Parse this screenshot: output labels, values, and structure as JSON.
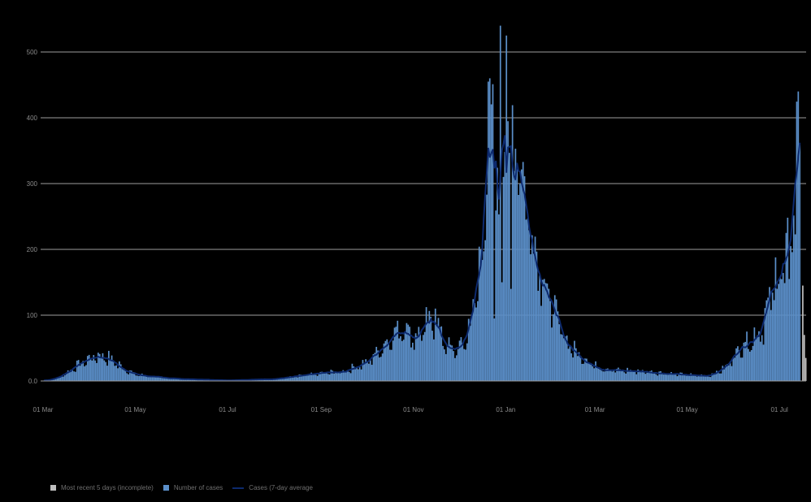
{
  "chart_data": {
    "type": "bar",
    "colors": {
      "bars": "#5b8fc9",
      "incomplete": "#bdbdbd",
      "line": "#0d2a6e",
      "grid": "#9e9e9e",
      "background": "#000000"
    },
    "x_start": "2020-03-01",
    "x_tick_labels": [
      "01 Mar",
      "01 May",
      "01 Jul",
      "01 Sep",
      "01 Nov",
      "01 Jan",
      "01 Mar",
      "01 May",
      "01 Jul"
    ],
    "x_tick_dates": [
      "2020-03-01",
      "2020-05-01",
      "2020-07-01",
      "2020-09-01",
      "2020-11-01",
      "2021-01-01",
      "2021-03-01",
      "2021-05-01",
      "2021-07-01"
    ],
    "y_ticks": [
      0,
      100,
      200,
      300,
      400,
      500
    ],
    "y_tick_labels": [
      "0.0",
      "100",
      "200",
      "300",
      "400",
      "500"
    ],
    "ylim": [
      0,
      540
    ],
    "grid": true,
    "legend_position": "bottom-left",
    "daily_anchors": [
      [
        "2020-03-01",
        0
      ],
      [
        "2020-03-10",
        4
      ],
      [
        "2020-03-18",
        15
      ],
      [
        "2020-03-25",
        26
      ],
      [
        "2020-04-01",
        35
      ],
      [
        "2020-04-07",
        40
      ],
      [
        "2020-04-15",
        32
      ],
      [
        "2020-04-22",
        20
      ],
      [
        "2020-05-01",
        10
      ],
      [
        "2020-05-15",
        6
      ],
      [
        "2020-06-01",
        3
      ],
      [
        "2020-07-01",
        1
      ],
      [
        "2020-08-01",
        3
      ],
      [
        "2020-08-20",
        8
      ],
      [
        "2020-09-01",
        12
      ],
      [
        "2020-09-15",
        14
      ],
      [
        "2020-10-01",
        28
      ],
      [
        "2020-10-10",
        50
      ],
      [
        "2020-10-18",
        70
      ],
      [
        "2020-10-25",
        82
      ],
      [
        "2020-11-01",
        65
      ],
      [
        "2020-11-10",
        85
      ],
      [
        "2020-11-15",
        90
      ],
      [
        "2020-11-22",
        55
      ],
      [
        "2020-11-28",
        45
      ],
      [
        "2020-12-05",
        60
      ],
      [
        "2020-12-12",
        130
      ],
      [
        "2020-12-18",
        250
      ],
      [
        "2020-12-22",
        390
      ],
      [
        "2020-12-26",
        330
      ],
      [
        "2020-12-30",
        360
      ],
      [
        "2021-01-02",
        390
      ],
      [
        "2021-01-06",
        370
      ],
      [
        "2021-01-12",
        300
      ],
      [
        "2021-01-18",
        230
      ],
      [
        "2021-01-25",
        160
      ],
      [
        "2021-02-01",
        110
      ],
      [
        "2021-02-08",
        70
      ],
      [
        "2021-02-15",
        45
      ],
      [
        "2021-02-22",
        35
      ],
      [
        "2021-03-01",
        22
      ],
      [
        "2021-03-15",
        16
      ],
      [
        "2021-04-01",
        15
      ],
      [
        "2021-04-15",
        12
      ],
      [
        "2021-05-01",
        9
      ],
      [
        "2021-05-15",
        8
      ],
      [
        "2021-05-25",
        18
      ],
      [
        "2021-06-01",
        40
      ],
      [
        "2021-06-07",
        58
      ],
      [
        "2021-06-12",
        62
      ],
      [
        "2021-06-20",
        85
      ],
      [
        "2021-06-25",
        130
      ],
      [
        "2021-06-30",
        165
      ],
      [
        "2021-07-03",
        175
      ],
      [
        "2021-07-06",
        190
      ],
      [
        "2021-07-09",
        250
      ],
      [
        "2021-07-12",
        330
      ],
      [
        "2021-07-14",
        360
      ]
    ],
    "spikes": [
      [
        "2020-12-20",
        455
      ],
      [
        "2020-12-21",
        460
      ],
      [
        "2020-12-24",
        95
      ],
      [
        "2020-12-28",
        540
      ],
      [
        "2020-12-29",
        150
      ],
      [
        "2021-01-01",
        525
      ],
      [
        "2021-01-04",
        140
      ],
      [
        "2021-01-08",
        325
      ],
      [
        "2021-01-10",
        300
      ],
      [
        "2020-11-15",
        110
      ],
      [
        "2020-10-27",
        88
      ],
      [
        "2020-04-06",
        43
      ],
      [
        "2021-07-07",
        155
      ],
      [
        "2021-07-13",
        440
      ],
      [
        "2021-07-15",
        325
      ],
      [
        "2021-07-05",
        225
      ]
    ],
    "incomplete_days": [
      [
        "2021-07-16",
        145
      ],
      [
        "2021-07-17",
        70
      ],
      [
        "2021-07-18",
        35
      ]
    ],
    "legend": [
      {
        "label": "Most recent 5 days (incomplete)",
        "kind": "incomplete"
      },
      {
        "label": "Number of cases",
        "kind": "bars"
      },
      {
        "label": "Cases (7-day average",
        "kind": "line"
      }
    ]
  }
}
